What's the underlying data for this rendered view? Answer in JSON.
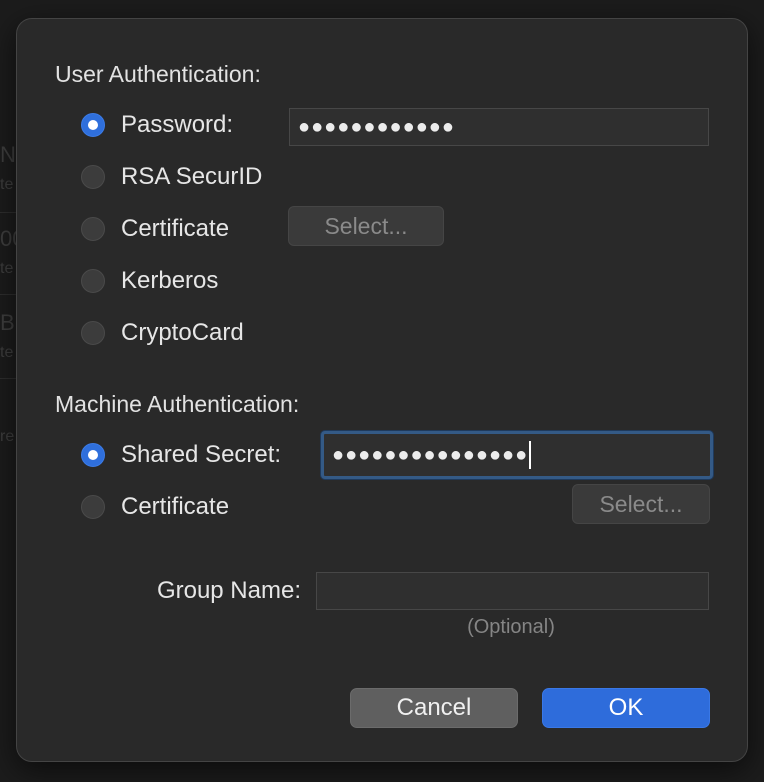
{
  "background": {
    "fragments": [
      "N",
      "te",
      "00",
      "te",
      "B",
      "te",
      "re"
    ]
  },
  "user_auth": {
    "title": "User Authentication:",
    "options": [
      {
        "label": "Password:",
        "checked": true
      },
      {
        "label": "RSA SecurID",
        "checked": false
      },
      {
        "label": "Certificate",
        "checked": false
      },
      {
        "label": "Kerberos",
        "checked": false
      },
      {
        "label": "CryptoCard",
        "checked": false
      }
    ],
    "password_value": "●●●●●●●●●●●●",
    "select_label": "Select..."
  },
  "machine_auth": {
    "title": "Machine Authentication:",
    "options": [
      {
        "label": "Shared Secret:",
        "checked": true
      },
      {
        "label": "Certificate",
        "checked": false
      }
    ],
    "shared_secret_value": "●●●●●●●●●●●●●●●",
    "select_label": "Select..."
  },
  "group": {
    "label": "Group Name:",
    "value": "",
    "hint": "(Optional)"
  },
  "buttons": {
    "cancel": "Cancel",
    "ok": "OK"
  },
  "colors": {
    "accent": "#2e6cdb",
    "sheet_background": "#292929",
    "focus_ring": "#345a86"
  }
}
